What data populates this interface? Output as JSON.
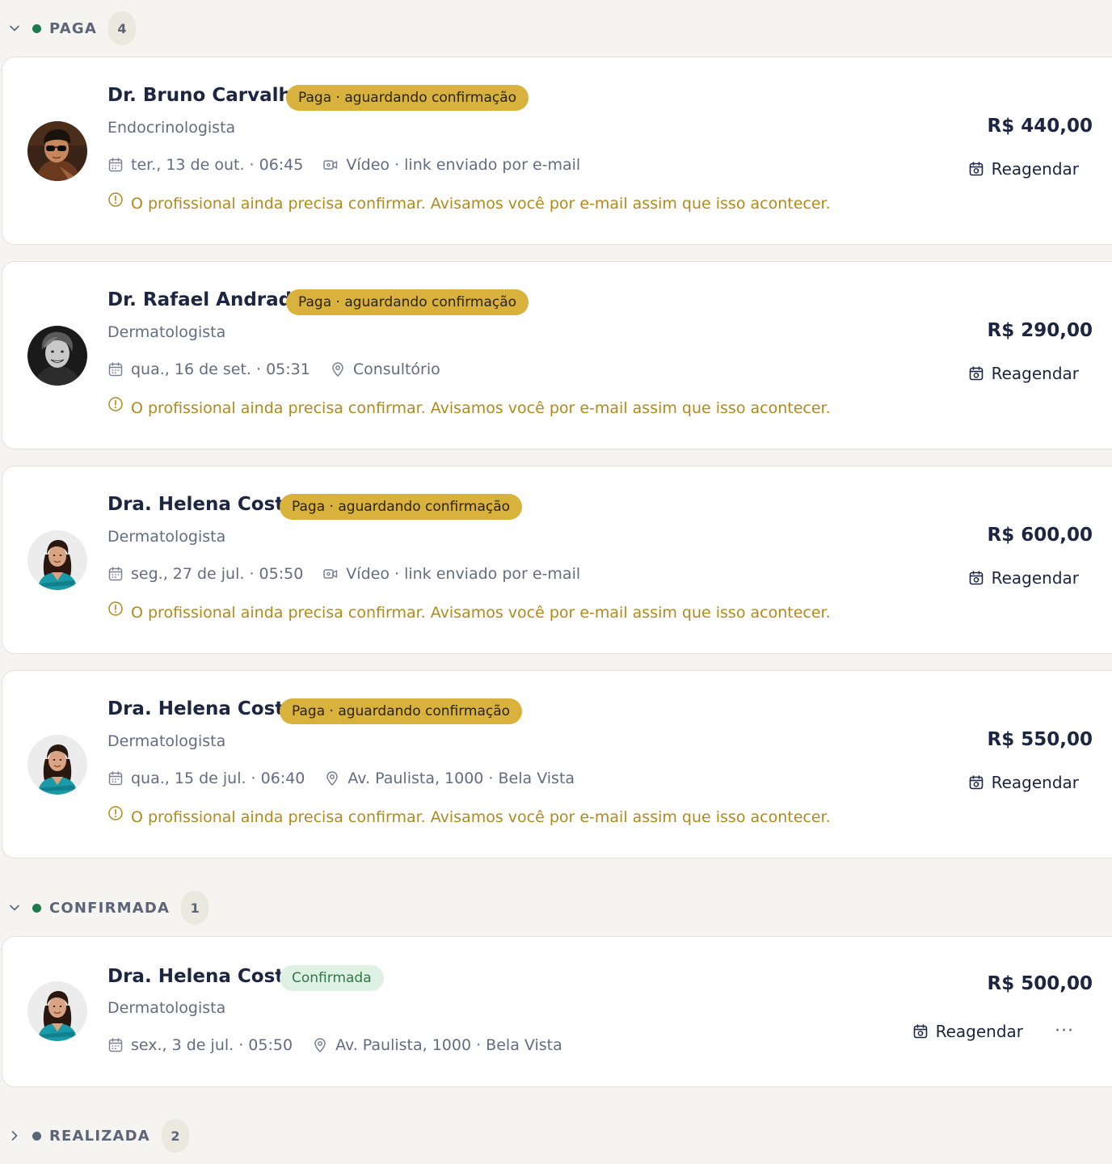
{
  "colors": {
    "status_dot_green": "#1f7a4a",
    "status_dot_gray": "#5c6478",
    "badge_pending": "#d8b23c",
    "badge_confirmed": "#dff1e4",
    "notice_text": "#b08a1c"
  },
  "groups": [
    {
      "label": "PAGA",
      "count": "4",
      "expanded": true,
      "cards": [
        {
          "name": "Dr. Bruno Carvalho",
          "badge": "Paga · aguardando confirmação",
          "specialty": "Endocrinologista",
          "datetime": "ter., 13 de out. · 06:45",
          "location_icon": "video-icon",
          "location": "Vídeo · link enviado por e-mail",
          "notice": "O profissional ainda precisa confirmar. Avisamos você por e-mail assim que isso acontecer.",
          "price": "R$ 440,00",
          "action": "Reagendar"
        },
        {
          "name": "Dr. Rafael Andrade",
          "badge": "Paga · aguardando confirmação",
          "specialty": "Dermatologista",
          "datetime": "qua., 16 de set. · 05:31",
          "location_icon": "map-pin-icon",
          "location": "Consultório",
          "notice": "O profissional ainda precisa confirmar. Avisamos você por e-mail assim que isso acontecer.",
          "price": "R$ 290,00",
          "action": "Reagendar"
        },
        {
          "name": "Dra. Helena Costa",
          "badge": "Paga · aguardando confirmação",
          "specialty": "Dermatologista",
          "datetime": "seg., 27 de jul. · 05:50",
          "location_icon": "video-icon",
          "location": "Vídeo · link enviado por e-mail",
          "notice": "O profissional ainda precisa confirmar. Avisamos você por e-mail assim que isso acontecer.",
          "price": "R$ 600,00",
          "action": "Reagendar"
        },
        {
          "name": "Dra. Helena Costa",
          "badge": "Paga · aguardando confirmação",
          "specialty": "Dermatologista",
          "datetime": "qua., 15 de jul. · 06:40",
          "location_icon": "map-pin-icon",
          "location": "Av. Paulista, 1000 · Bela Vista",
          "notice": "O profissional ainda precisa confirmar. Avisamos você por e-mail assim que isso acontecer.",
          "price": "R$ 550,00",
          "action": "Reagendar"
        }
      ]
    },
    {
      "label": "CONFIRMADA",
      "count": "1",
      "expanded": true,
      "cards": [
        {
          "name": "Dra. Helena Costa",
          "badge": "Confirmada",
          "specialty": "Dermatologista",
          "datetime": "sex., 3 de jul. · 05:50",
          "location_icon": "map-pin-icon",
          "location": "Av. Paulista, 1000 · Bela Vista",
          "price": "R$ 500,00",
          "action": "Reagendar",
          "more": "···"
        }
      ]
    },
    {
      "label": "REALIZADA",
      "count": "2",
      "expanded": false,
      "cards": []
    }
  ]
}
